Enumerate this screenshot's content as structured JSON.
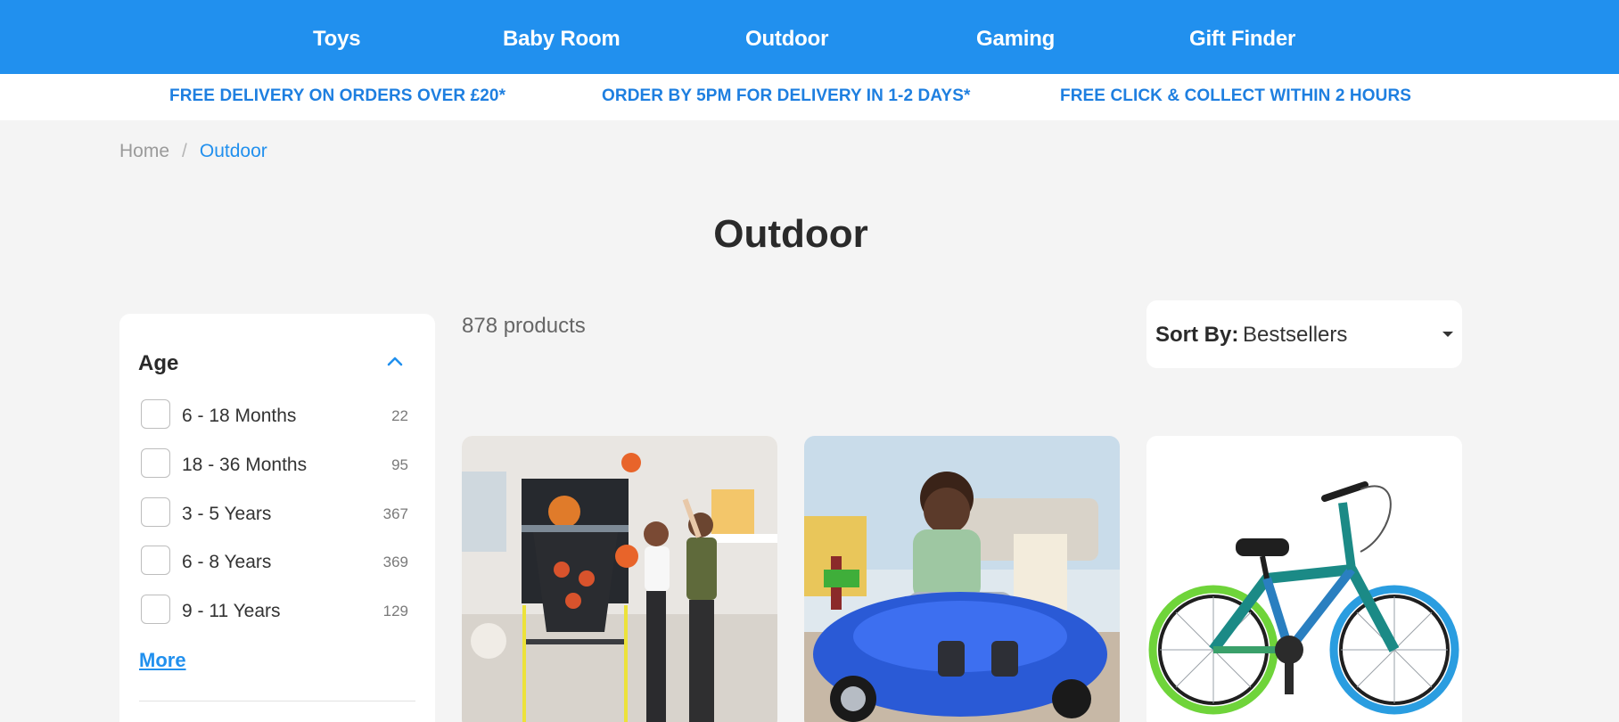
{
  "nav": {
    "items": [
      {
        "label": "Toys"
      },
      {
        "label": "Baby Room"
      },
      {
        "label": "Outdoor"
      },
      {
        "label": "Gaming"
      },
      {
        "label": "Gift Finder"
      }
    ]
  },
  "promo": {
    "items": [
      "FREE DELIVERY ON ORDERS OVER £20*",
      "ORDER BY 5PM FOR DELIVERY IN 1-2 DAYS*",
      "FREE CLICK & COLLECT WITHIN 2 HOURS"
    ]
  },
  "breadcrumb": {
    "home": "Home",
    "separator": "/",
    "current": "Outdoor"
  },
  "page": {
    "title": "Outdoor",
    "product_count": "878 products"
  },
  "filters": {
    "title": "Age",
    "options": [
      {
        "label": "6 - 18 Months",
        "count": "22"
      },
      {
        "label": "18 - 36 Months",
        "count": "95"
      },
      {
        "label": "3 - 5 Years",
        "count": "367"
      },
      {
        "label": "6 - 8 Years",
        "count": "369"
      },
      {
        "label": "9 - 11 Years",
        "count": "129"
      }
    ],
    "more_label": "More"
  },
  "sort": {
    "label": "Sort By:",
    "value": "Bestsellers"
  },
  "colors": {
    "brand_blue": "#2190ee",
    "promo_blue": "#1e7fe0",
    "page_bg": "#f4f4f4"
  },
  "icons": {
    "filter_toggle": "chevron-up-icon",
    "sort_dropdown": "caret-down-icon"
  }
}
